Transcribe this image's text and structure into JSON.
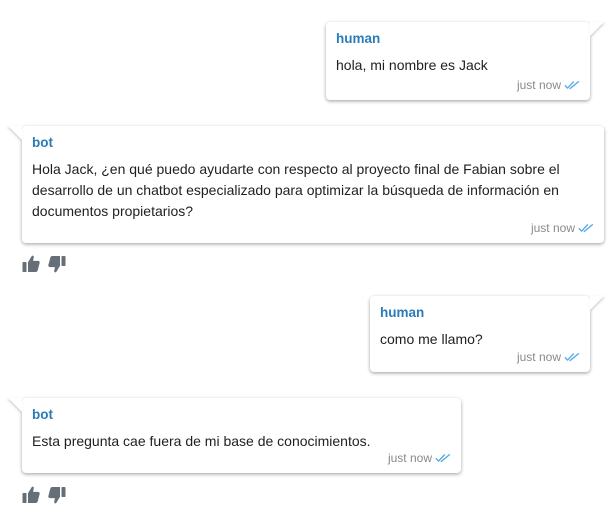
{
  "colors": {
    "sender_name": "#2b7bb9",
    "message_text": "#1f1f1f",
    "timestamp": "#8a8a8a",
    "read_receipt": "#4fa7e6",
    "feedback_icon": "#666e78"
  },
  "messages": [
    {
      "sender": "human",
      "text": "hola, mi nombre es Jack",
      "time": "just now",
      "status_icon": "double-check-icon"
    },
    {
      "sender": "bot",
      "text": "Hola Jack, ¿en qué puedo ayudarte con respecto al proyecto final de Fabian sobre el desarrollo de un chatbot especializado para optimizar la búsqueda de información en documentos propietarios?",
      "time": "just now",
      "status_icon": "double-check-icon",
      "feedback_icons": [
        "thumbs-up-icon",
        "thumbs-down-icon"
      ]
    },
    {
      "sender": "human",
      "text": "como me llamo?",
      "time": "just now",
      "status_icon": "double-check-icon"
    },
    {
      "sender": "bot",
      "text": "Esta pregunta cae fuera de mi base de conocimientos.",
      "time": "just now",
      "status_icon": "double-check-icon",
      "feedback_icons": [
        "thumbs-up-icon",
        "thumbs-down-icon"
      ]
    }
  ]
}
